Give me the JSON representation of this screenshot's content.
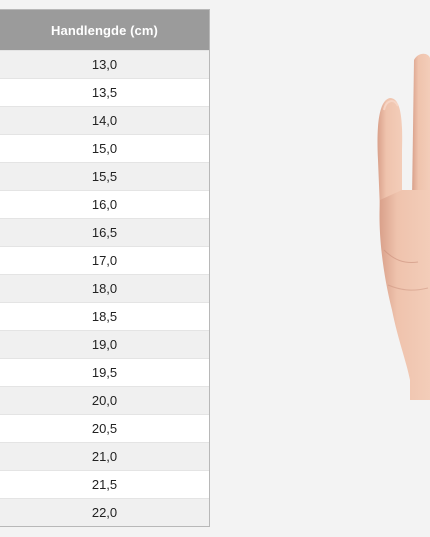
{
  "table": {
    "header": "Handlengde (cm)",
    "rows": [
      "13,0",
      "13,5",
      "14,0",
      "15,0",
      "15,5",
      "16,0",
      "16,5",
      "17,0",
      "18,0",
      "18,5",
      "19,0",
      "19,5",
      "20,0",
      "20,5",
      "21,0",
      "21,5",
      "22,0"
    ]
  },
  "image": {
    "subject": "hand-photo"
  },
  "colors": {
    "header_bg": "#9b9b9b",
    "row_alt": "#f0f0f0",
    "page_bg": "#f3f3f3",
    "skin": "#e9b9a3"
  }
}
